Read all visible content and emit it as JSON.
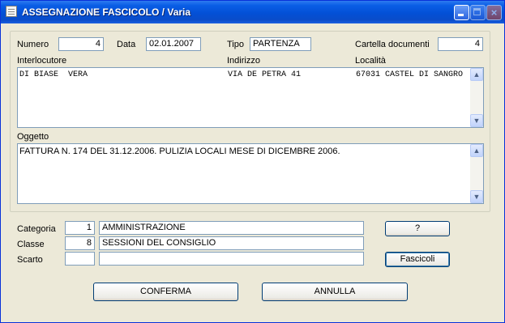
{
  "window": {
    "title": "ASSEGNAZIONE FASCICOLO / Varia",
    "icon": "document-icon"
  },
  "header": {
    "numero_label": "Numero",
    "numero_value": "4",
    "data_label": "Data",
    "data_value": "02.01.2007",
    "tipo_label": "Tipo",
    "tipo_value": "PARTENZA",
    "cartella_label": "Cartella documenti",
    "cartella_value": "4"
  },
  "interlocutore": {
    "col_interlocutore": "Interlocutore",
    "col_indirizzo": "Indirizzo",
    "col_localita": "Località",
    "rows": [
      {
        "nome": "DI BIASE  VERA",
        "indirizzo": "VIA DE PETRA 41",
        "localita": "67031 CASTEL DI SANGRO"
      }
    ]
  },
  "oggetto": {
    "label": "Oggetto",
    "text": "FATTURA N. 174 DEL 31.12.2006. PULIZIA LOCALI MESE DI DICEMBRE 2006."
  },
  "classificazione": {
    "categoria_label": "Categoria",
    "categoria_code": "1",
    "categoria_desc": "AMMINISTRAZIONE",
    "classe_label": "Classe",
    "classe_code": "8",
    "classe_desc": "SESSIONI DEL CONSIGLIO",
    "scarto_label": "Scarto",
    "scarto_code": "",
    "scarto_desc": ""
  },
  "buttons": {
    "help": "?",
    "fascicoli": "Fascicoli",
    "conferma": "CONFERMA",
    "annulla": "ANNULLA"
  }
}
